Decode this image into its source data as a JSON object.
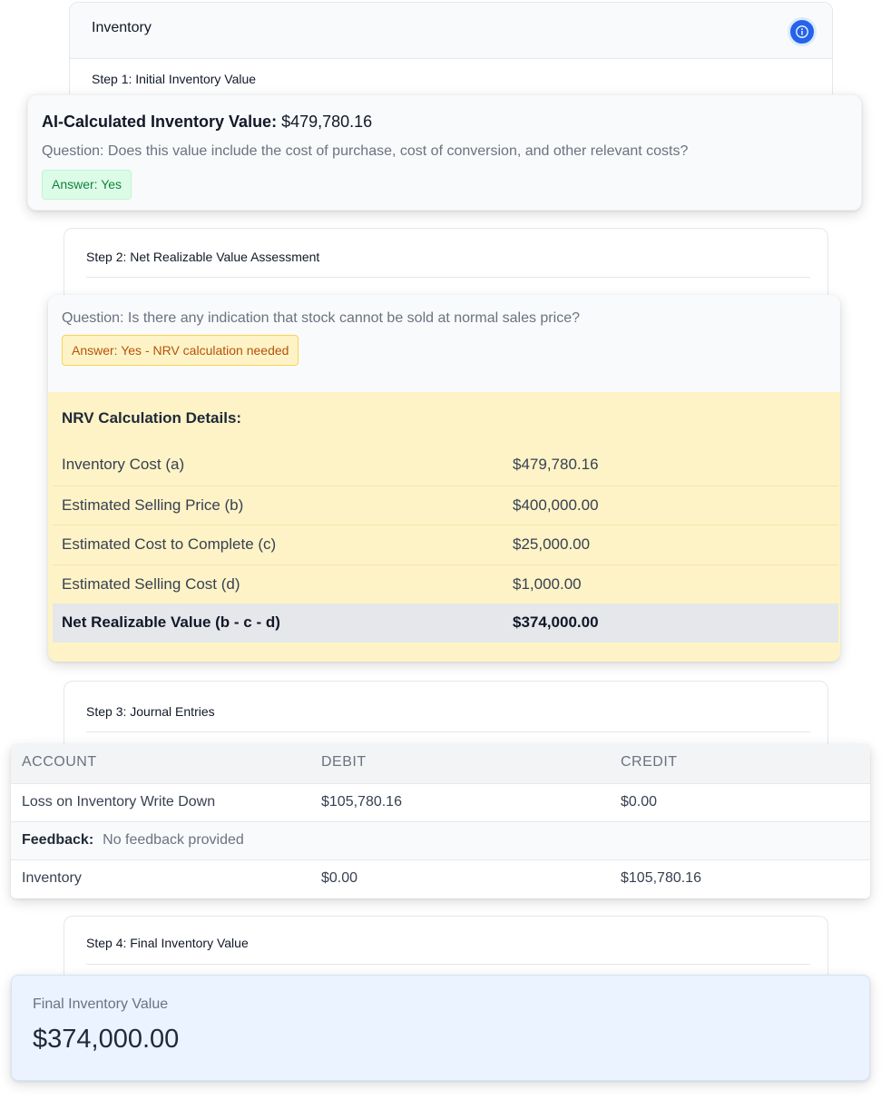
{
  "inventory_section": {
    "title": "Inventory",
    "info_icon": "info-icon",
    "accent_color": "#2563eb"
  },
  "step1": {
    "label": "Step 1: Initial Inventory Value",
    "ai_value_label": "AI-Calculated Inventory Value:",
    "ai_value": "$479,780.16",
    "question": "Question: Does this value include the cost of purchase, cost of conversion, and other relevant costs?",
    "answer": "Answer: Yes"
  },
  "step2": {
    "label": "Step 2: Net Realizable Value Assessment",
    "question": "Question: Is there any indication that stock cannot be sold at normal sales price?",
    "answer": "Answer: Yes - NRV calculation needed",
    "nrv_title": "NRV Calculation Details:",
    "nrv_rows": [
      {
        "label": "Inventory Cost (a)",
        "value": "$479,780.16"
      },
      {
        "label": "Estimated Selling Price (b)",
        "value": "$400,000.00"
      },
      {
        "label": "Estimated Cost to Complete (c)",
        "value": "$25,000.00"
      },
      {
        "label": "Estimated Selling Cost (d)",
        "value": "$1,000.00"
      }
    ],
    "nrv_total": {
      "label": "Net Realizable Value (b - c - d)",
      "value": "$374,000.00"
    }
  },
  "step3": {
    "label": "Step 3: Journal Entries",
    "columns": [
      "ACCOUNT",
      "DEBIT",
      "CREDIT"
    ],
    "rows": [
      {
        "account": "Loss on Inventory Write Down",
        "debit": "$105,780.16",
        "credit": "$0.00"
      },
      {
        "account": "Inventory",
        "debit": "$0.00",
        "credit": "$105,780.16"
      }
    ],
    "feedback_label": "Feedback:",
    "feedback_text": "No feedback provided"
  },
  "step4": {
    "label": "Step 4: Final Inventory Value",
    "final_label": "Final Inventory Value",
    "final_value": "$374,000.00"
  }
}
